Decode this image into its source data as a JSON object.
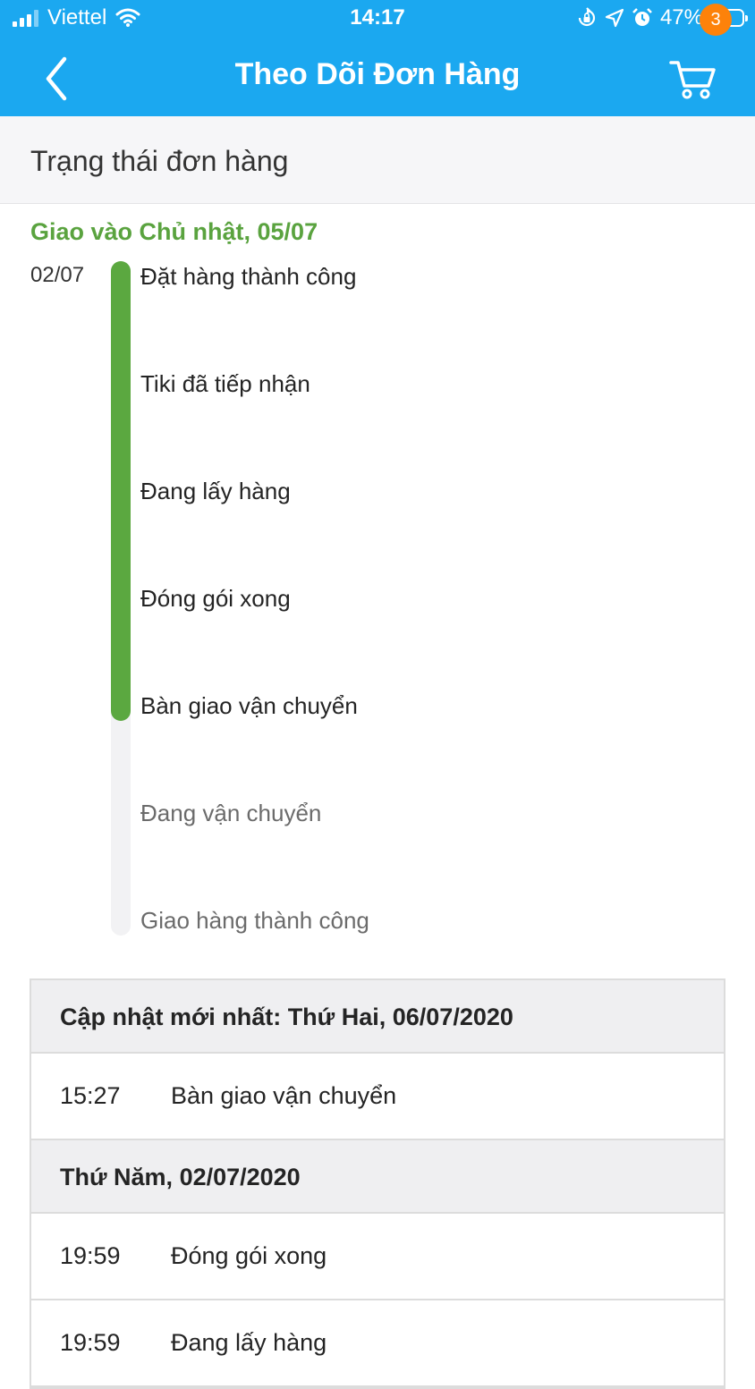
{
  "status_bar": {
    "carrier": "Viettel",
    "time": "14:17",
    "battery": "47%",
    "battery_level": 0.47
  },
  "header": {
    "title": "Theo Dõi Đơn Hàng",
    "cart_count": "3"
  },
  "section": {
    "title": "Trạng thái đơn hàng"
  },
  "delivery": {
    "text": "Giao vào Chủ nhật, 05/07",
    "start_date": "02/07"
  },
  "timeline": {
    "completed_steps": 5,
    "steps": [
      "Đặt hàng thành công",
      "Tiki đã tiếp nhận",
      "Đang lấy hàng",
      "Đóng gói xong",
      "Bàn giao vận chuyển",
      "Đang vận chuyển",
      "Giao hàng thành công"
    ]
  },
  "history": {
    "groups": [
      {
        "header": "Cập nhật mới nhất: Thứ Hai, 06/07/2020",
        "entries": [
          {
            "time": "15:27",
            "desc": "Bàn giao vận chuyển"
          }
        ]
      },
      {
        "header": "Thứ Năm, 02/07/2020",
        "entries": [
          {
            "time": "19:59",
            "desc": "Đóng gói xong"
          },
          {
            "time": "19:59",
            "desc": "Đang lấy hàng"
          }
        ]
      }
    ]
  },
  "colors": {
    "header_bg": "#1ba8f0",
    "accent_green": "#5ba840",
    "badge": "#fd820a"
  },
  "icons": [
    "back-chevron-icon",
    "cart-icon",
    "signal-icon",
    "wifi-icon",
    "lock-rotation-icon",
    "location-icon",
    "alarm-icon",
    "battery-icon"
  ]
}
